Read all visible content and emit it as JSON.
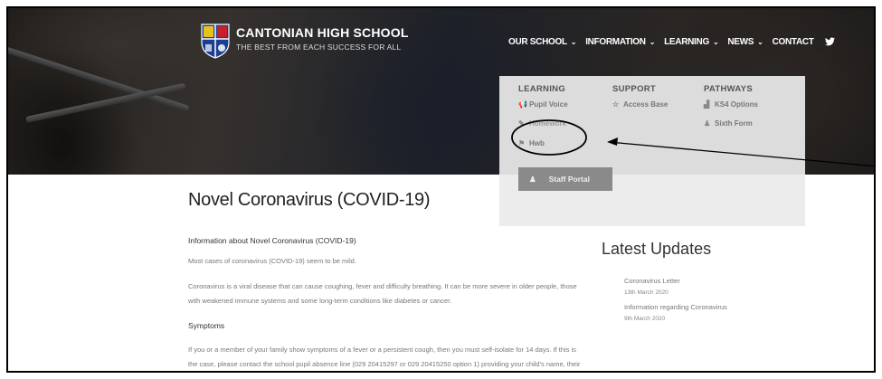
{
  "header": {
    "school_name": "CANTONIAN HIGH SCHOOL",
    "tagline": "THE BEST FROM EACH SUCCESS FOR ALL"
  },
  "nav": {
    "items": [
      {
        "label": "OUR SCHOOL",
        "chevron": "⌄"
      },
      {
        "label": "INFORMATION",
        "chevron": "⌄"
      },
      {
        "label": "LEARNING",
        "chevron": "⌄"
      },
      {
        "label": "NEWS",
        "chevron": "⌄"
      },
      {
        "label": "CONTACT",
        "chevron": ""
      }
    ],
    "social_icon": "twitter-icon"
  },
  "mega_menu": {
    "columns": [
      {
        "heading": "LEARNING",
        "links": [
          {
            "label": "Pupil Voice",
            "icon": "megaphone-icon"
          },
          {
            "label": "Homework",
            "icon": "pencil-icon"
          },
          {
            "label": "Hwb",
            "icon": "flag-icon"
          }
        ]
      },
      {
        "heading": "SUPPORT",
        "links": [
          {
            "label": "Access Base",
            "icon": "star-icon"
          }
        ]
      },
      {
        "heading": "PATHWAYS",
        "links": [
          {
            "label": "KS4 Options",
            "icon": "bar-chart-icon"
          },
          {
            "label": "Sixth Form",
            "icon": "graduate-icon"
          }
        ]
      }
    ],
    "staff_portal_label": "Staff Portal"
  },
  "main": {
    "title": "Novel Coronavirus (COVID-19)",
    "intro_heading": "Information about Novel Coronavirus (COVID-19)",
    "p1": "Most cases of coronavirus (COVID-19) seem to be mild.",
    "p2": "Coronavirus is a viral disease that can cause coughing, fever and difficulty breathing. It can be more severe in older people, those with weakened immune systems and some long-term conditions like diabetes or cancer.",
    "symptoms_heading": "Symptoms",
    "p3": "If you or a member of your family show symptoms of a fever or a persistent cough, then you must self-isolate for 14 days. If this is the case, please contact the school pupil absence line (029 20415297 or 029 20415250 option 1) providing your child's name, their"
  },
  "sidebar": {
    "title": "Latest Updates",
    "updates": [
      {
        "label": "Coronavirus Letter",
        "date": "13th March 2020"
      },
      {
        "label": "Information regarding Coronavirus",
        "date": "9th March 2020"
      }
    ]
  },
  "colors": {
    "menu_bg": "#ebebeb",
    "staff_portal_bg": "#8a8a8a",
    "nav_text": "#ffffff"
  }
}
